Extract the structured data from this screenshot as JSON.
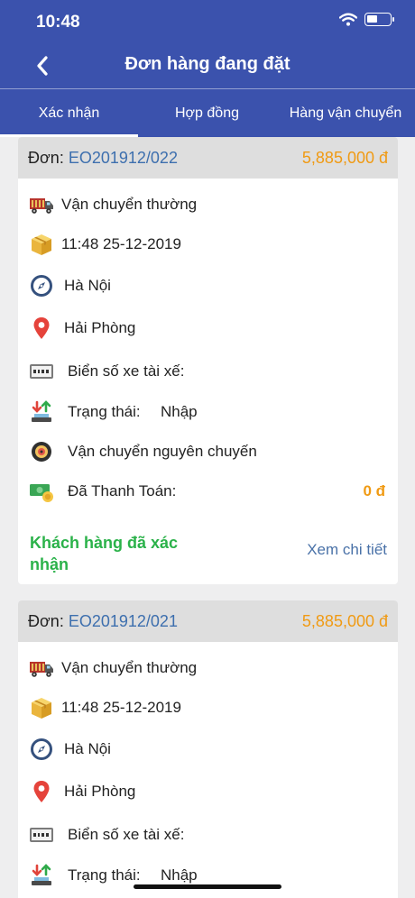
{
  "status_bar": {
    "time": "10:48"
  },
  "nav": {
    "title": "Đơn hàng đang đặt"
  },
  "tabs": [
    {
      "label": "Xác nhận",
      "active": true
    },
    {
      "label": "Hợp đồng",
      "active": false
    },
    {
      "label": "Hàng vận chuyển",
      "active": false
    }
  ],
  "colors": {
    "header": "#3b52ad",
    "price": "#f09a13",
    "order_code": "#3d6fae",
    "confirmed": "#2bb24a",
    "link": "#4a72a8"
  },
  "orders": [
    {
      "prefix": "Đơn:",
      "code": "EO201912/022",
      "price": "5,885,000 đ",
      "shipping_type": "Vận chuyển thường",
      "datetime": "11:48 25-12-2019",
      "origin": "Hà Nội",
      "destination": "Hải Phòng",
      "plate_label": "Biển số xe tài xế:",
      "status_label": "Trạng thái:",
      "status_value": "Nhập",
      "transport_mode": "Vận chuyển nguyên chuyến",
      "paid_label": "Đã Thanh Toán:",
      "paid_value": "0 đ",
      "confirm_text": "Khách hàng đã xác nhận",
      "detail_link": "Xem chi tiết"
    },
    {
      "prefix": "Đơn:",
      "code": "EO201912/021",
      "price": "5,885,000 đ",
      "shipping_type": "Vận chuyển thường",
      "datetime": "11:48 25-12-2019",
      "origin": "Hà Nội",
      "destination": "Hải Phòng",
      "plate_label": "Biển số xe tài xế:",
      "status_label": "Trạng thái:",
      "status_value": "Nhập"
    }
  ]
}
